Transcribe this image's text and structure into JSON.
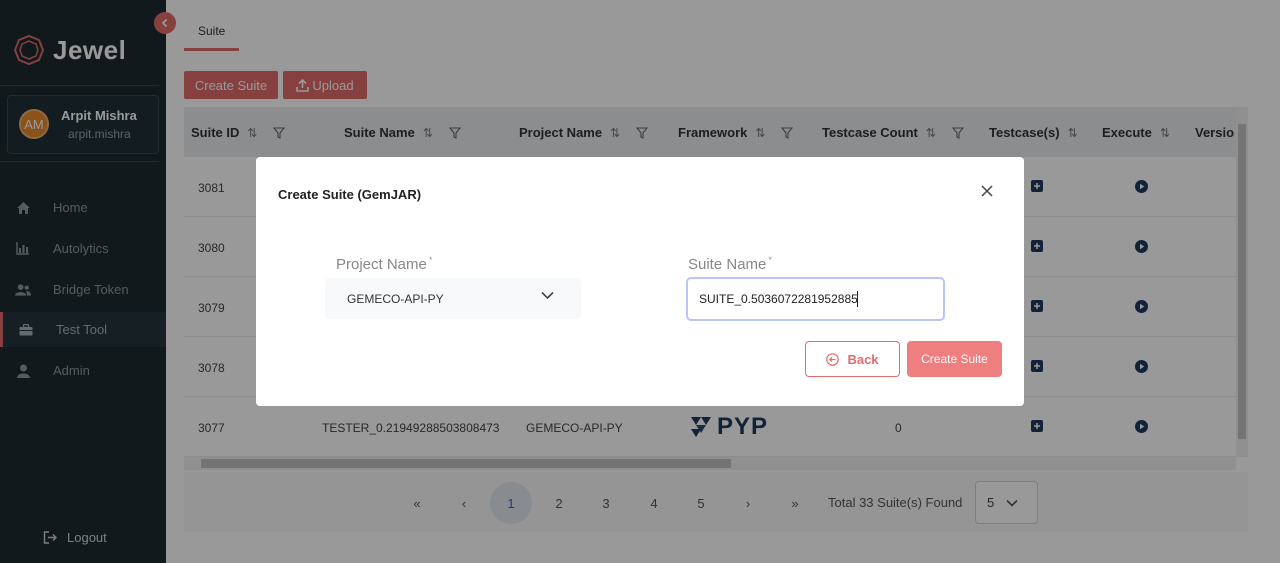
{
  "brand": {
    "name": "Jewel"
  },
  "user": {
    "initials": "AM",
    "name": "Arpit Mishra",
    "handle": "arpit.mishra"
  },
  "nav": {
    "items": [
      {
        "label": "Home",
        "icon": "home-icon"
      },
      {
        "label": "Autolytics",
        "icon": "bar-chart-icon"
      },
      {
        "label": "Bridge Token",
        "icon": "users-icon"
      },
      {
        "label": "Test Tool",
        "icon": "toolbox-icon",
        "active": true
      },
      {
        "label": "Admin",
        "icon": "user-icon"
      }
    ],
    "logout": "Logout"
  },
  "tabs": [
    {
      "label": "Suite",
      "active": true
    }
  ],
  "toolbar": {
    "create_label": "Create Suite",
    "upload_label": "Upload"
  },
  "table": {
    "headers": [
      "Suite ID",
      "Suite Name",
      "Project Name",
      "Framework",
      "Testcase Count",
      "Testcase(s)",
      "Execute",
      "Versio"
    ],
    "rows": [
      {
        "id": "3081"
      },
      {
        "id": "3080"
      },
      {
        "id": "3079"
      },
      {
        "id": "3078"
      },
      {
        "id": "3077",
        "suite_name": "TESTER_0.21949288503808473",
        "project": "GEMECO-API-PY",
        "framework": "PYP",
        "count": "0"
      }
    ]
  },
  "pagination": {
    "first": "«",
    "prev": "‹",
    "pages": [
      "1",
      "2",
      "3",
      "4",
      "5"
    ],
    "active_page": "1",
    "next": "›",
    "last": "»",
    "total_text": "Total 33 Suite(s) Found",
    "page_size": "5"
  },
  "modal": {
    "title": "Create Suite (GemJAR)",
    "project_label": "Project Name",
    "project_value": "GEMECO-API-PY",
    "suite_label": "Suite Name",
    "suite_value": "SUITE_0.5036072281952885",
    "required_mark": "*",
    "back_label": "Back",
    "submit_label": "Create Suite"
  },
  "colors": {
    "accent": "#e06c6c",
    "sidebar": "#1e2a30",
    "overlay": "rgba(0,0,0,0.4)"
  }
}
